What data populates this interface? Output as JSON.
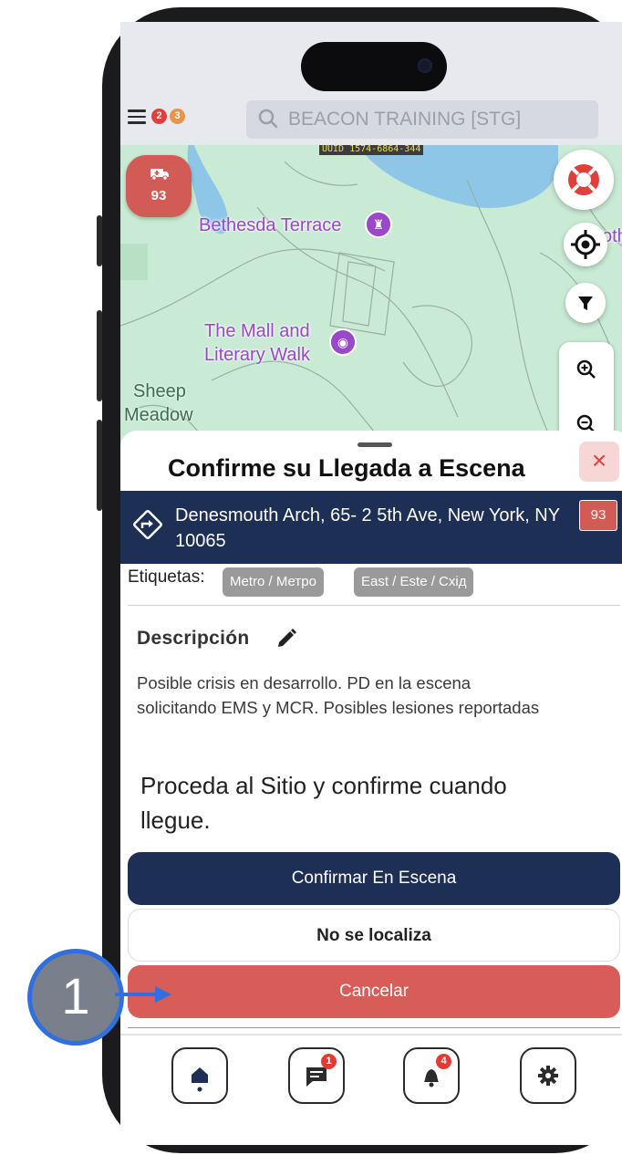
{
  "header": {
    "menu_badges": [
      "2",
      "3"
    ],
    "search_placeholder": "BEACON TRAINING [STG]"
  },
  "map": {
    "uuid_label": "UUID 1574-6864-344",
    "unit_count": "93",
    "labels": {
      "bethesda": "Bethesda Terrace",
      "mall_line1": "The Mall and",
      "mall_line2": "Literary Walk",
      "sheep_line1": "Sheep",
      "sheep_line2": "Meadow",
      "edge": "oth"
    }
  },
  "sheet": {
    "title": "Confirme su Llegada a Escena",
    "close_label": "×",
    "address": "Denesmouth Arch, 65- 2 5th Ave, New York, NY 10065",
    "address_number": "93",
    "tags_label": "Etiquetas:",
    "tags": [
      "Metro /  Метро",
      "East / Este / Схід"
    ],
    "description_heading": "Descripción",
    "description": "Posible crisis en desarrollo. PD en la escena solicitando EMS y MCR. Posibles lesiones reportadas",
    "instruction": "Proceda al Sitio y confirme cuando llegue.",
    "buttons": {
      "confirm": "Confirmar En Escena",
      "not_found": "No se localiza",
      "cancel": "Cancelar"
    }
  },
  "bottom_nav": {
    "messages_badge": "1",
    "alerts_badge": "4"
  },
  "callout": {
    "step": "1"
  },
  "colors": {
    "navy": "#1e2f55",
    "danger": "#d85c58",
    "callout_border": "#2f6fe0"
  }
}
